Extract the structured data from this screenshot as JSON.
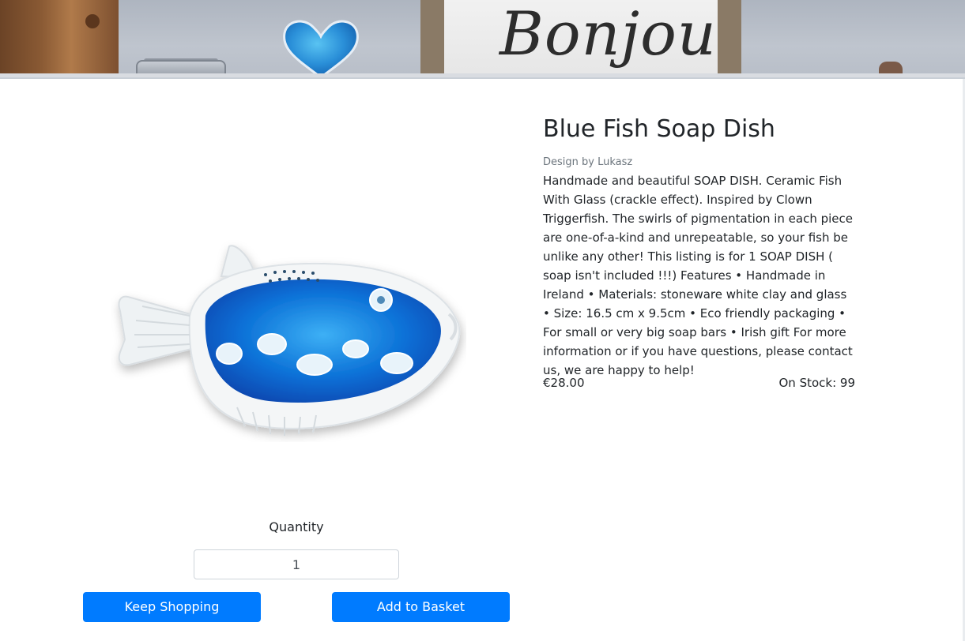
{
  "banner": {
    "sign_text": "Bonjour"
  },
  "product": {
    "title": "Blue Fish Soap Dish",
    "designer": "Design by Lukasz",
    "description": "Handmade and beautiful SOAP DISH. Ceramic Fish With Glass (crackle effect). Inspired by Clown Triggerfish. The swirls of pigmentation in each piece are one-of-a-kind and unrepeatable, so your fish be unlike any other! This listing is for 1 SOAP DISH ( soap isn't included !!!) Features • Handmade in Ireland • Materials: stoneware white clay and glass • Size: 16.5 cm x 9.5cm • Eco friendly packaging • For small or very big soap bars • Irish gift For more information or if you have questions, please contact us, we are happy to help!",
    "price": "€28.00",
    "stock": "On Stock: 99"
  },
  "quantity": {
    "label": "Quantity",
    "value": "1"
  },
  "actions": {
    "keep_shopping": "Keep Shopping",
    "add_to_basket": "Add to Basket"
  },
  "colors": {
    "primary": "#007bff",
    "glaze_blue": "#0a6fd6",
    "text": "#212529",
    "muted": "#6c757d"
  }
}
